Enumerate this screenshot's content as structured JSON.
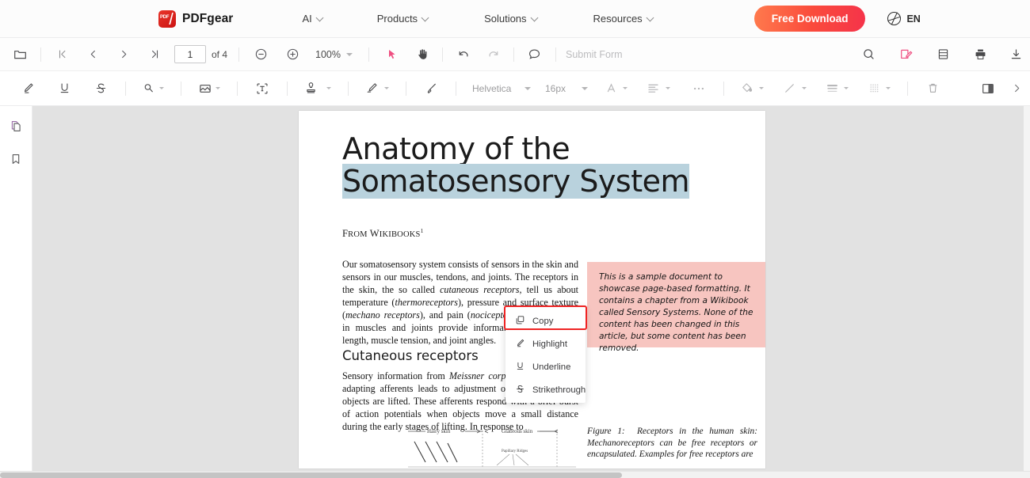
{
  "topnav": {
    "brand": "PDFgear",
    "items": [
      {
        "label": "AI"
      },
      {
        "label": "Products"
      },
      {
        "label": "Solutions"
      },
      {
        "label": "Resources"
      }
    ],
    "cta": "Free Download",
    "language": "EN"
  },
  "toolbar1": {
    "open_label": "open-file",
    "page_value": "1",
    "page_total": "of 4",
    "zoom_level": "100%",
    "submit_form": "Submit Form"
  },
  "toolbar2": {
    "font_family": "Helvetica",
    "font_size": "16px"
  },
  "context_menu": {
    "items": [
      {
        "label": "Copy",
        "icon": "copy-icon",
        "highlighted": true
      },
      {
        "label": "Highlight",
        "icon": "highlight-pen-icon",
        "highlighted": false
      },
      {
        "label": "Underline",
        "icon": "underline-icon",
        "highlighted": false
      },
      {
        "label": "Strikethrough",
        "icon": "strikethrough-icon",
        "highlighted": false
      }
    ],
    "accent_color": "#ef2424"
  },
  "document": {
    "title_line1": "Anatomy of the",
    "title_line2_selected": "Somatosensory System",
    "byline_prefix": "F",
    "byline_rest": "ROM ",
    "byline_w": "W",
    "byline_wiki": "IKIBOOKS",
    "byline_sup": "1",
    "paragraph1": "Our somatosensory system consists of sensors in the skin and sensors in our muscles, tendons, and joints. The receptors in the skin, the so called cutaneous receptors, tell us about temperature (thermoreceptors), pressure and surface texture (mechano receptors), and pain (nociceptors). The receptors in muscles and joints provide information about muscle length, muscle tension, and joint angles.",
    "section_heading": "Cutaneous receptors",
    "paragraph2": "Sensory information from Meissner corpuscles and rapidly adapting afferents leads to adjustment of grip force when objects are lifted. These afferents respond with a brief burst of action potentials when objects move a small distance during the early stages of lifting. In response to",
    "note_box": "This is a sample document to showcase page-based formatting. It contains a chapter from a Wikibook called Sensory Systems. None of the content has been changed in this article, but some content has been removed.",
    "note_box_color": "#f7c5c0",
    "figure_caption": "Figure 1: Receptors in the human skin: Mechanoreceptors can be free receptors or encapsulated. Examples for free receptors are",
    "figure_labels": {
      "hairy_skin": "Hairy skin",
      "glabrous_skin": "Glabrous skin",
      "papillary_ridges": "Papillary Ridges"
    },
    "selection_color": "#b9d2dd"
  }
}
